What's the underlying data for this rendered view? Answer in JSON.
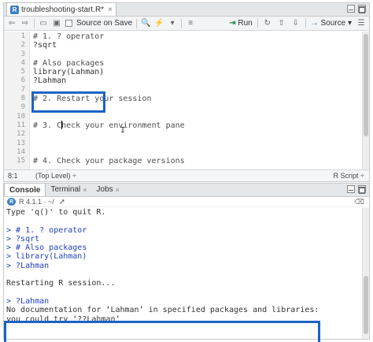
{
  "editor": {
    "tab_label": "troubleshooting-start.R*",
    "toolbar": {
      "source_on_save": "Source on Save",
      "run": "Run",
      "source": "Source"
    },
    "lines": [
      {
        "num": "1",
        "text": "# 1. ? operator"
      },
      {
        "num": "2",
        "text": "?sqrt"
      },
      {
        "num": "3",
        "text": ""
      },
      {
        "num": "4",
        "text": "# Also packages"
      },
      {
        "num": "5",
        "text": "library(Lahman)"
      },
      {
        "num": "6",
        "text": "?Lahman"
      },
      {
        "num": "7",
        "text": ""
      },
      {
        "num": "8",
        "text": "# 2. Restart your session"
      },
      {
        "num": "9",
        "text": ""
      },
      {
        "num": "10",
        "text": ""
      },
      {
        "num": "11",
        "text": "# 3. Check your environment pane"
      },
      {
        "num": "12",
        "text": ""
      },
      {
        "num": "13",
        "text": ""
      },
      {
        "num": "14",
        "text": ""
      },
      {
        "num": "15",
        "text": "# 4. Check your package versions"
      }
    ],
    "status": {
      "position": "8:1",
      "scope": "(Top Level) ÷",
      "file_type": "R Script ÷"
    }
  },
  "console": {
    "tabs": [
      {
        "label": "Console"
      },
      {
        "label": "Terminal"
      },
      {
        "label": "Jobs"
      }
    ],
    "r_version": "R 4.1.1 · ~/",
    "lines": [
      {
        "text": "Type 'q()' to quit R."
      },
      {
        "text": ""
      },
      {
        "text": "> # 1. ? operator"
      },
      {
        "text": "> ?sqrt"
      },
      {
        "text": "> # Also packages"
      },
      {
        "text": "> library(Lahman)"
      },
      {
        "text": "> ?Lahman"
      },
      {
        "text": ""
      },
      {
        "text": "Restarting R session..."
      },
      {
        "text": ""
      },
      {
        "text": "> ?Lahman"
      },
      {
        "text": "No documentation for ‘Lahman’ in specified packages and libraries:"
      },
      {
        "text": "you could try ‘??Lahman’"
      }
    ]
  },
  "colors": {
    "highlight": "#1a63c6",
    "prompt": "#1f3fbf"
  }
}
